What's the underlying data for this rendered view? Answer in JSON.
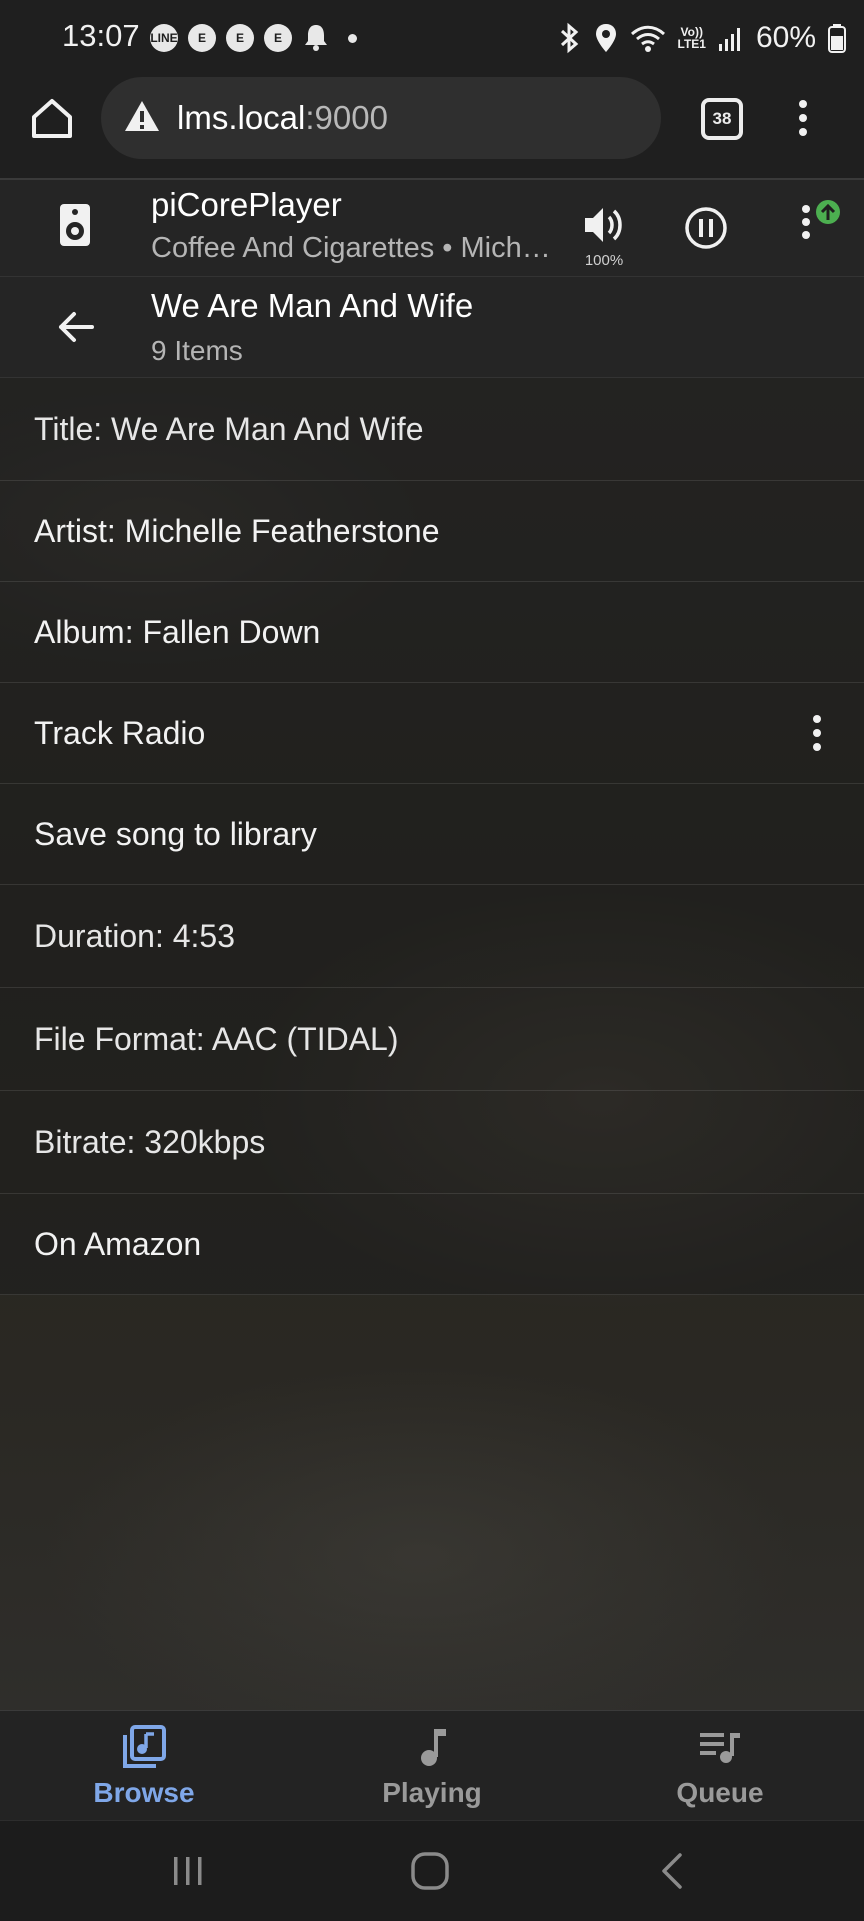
{
  "status_bar": {
    "time": "13:07",
    "notification_icons": [
      "line-icon",
      "e-badge-icon",
      "e-badge-icon",
      "e-badge-icon",
      "bell-icon"
    ],
    "signal_label_top": "Vo))",
    "signal_label_bottom": "LTE1",
    "battery_percent": "60%"
  },
  "browser": {
    "url_host": "lms.local",
    "url_port": ":9000",
    "tab_count": "38"
  },
  "player": {
    "name": "piCorePlayer",
    "now_playing": "Coffee And Cigarettes • Michelle Featherstone",
    "volume": "100%"
  },
  "header": {
    "title": "We Are Man And Wife",
    "subtitle": "9 Items"
  },
  "items": [
    {
      "label": "Title: We Are Man And Wife"
    },
    {
      "label": "Artist: Michelle Featherstone"
    },
    {
      "label": "Album: Fallen Down"
    },
    {
      "label": "Track Radio"
    },
    {
      "label": "Save song to library"
    },
    {
      "label": "Duration: 4:53"
    },
    {
      "label": "File Format: AAC (TIDAL)"
    },
    {
      "label": "Bitrate: 320kbps"
    },
    {
      "label": "On Amazon"
    }
  ],
  "bottom_nav": {
    "browse": "Browse",
    "playing": "Playing",
    "queue": "Queue",
    "active_color": "#7fa7e8",
    "inactive_color": "#9a9a9a"
  }
}
